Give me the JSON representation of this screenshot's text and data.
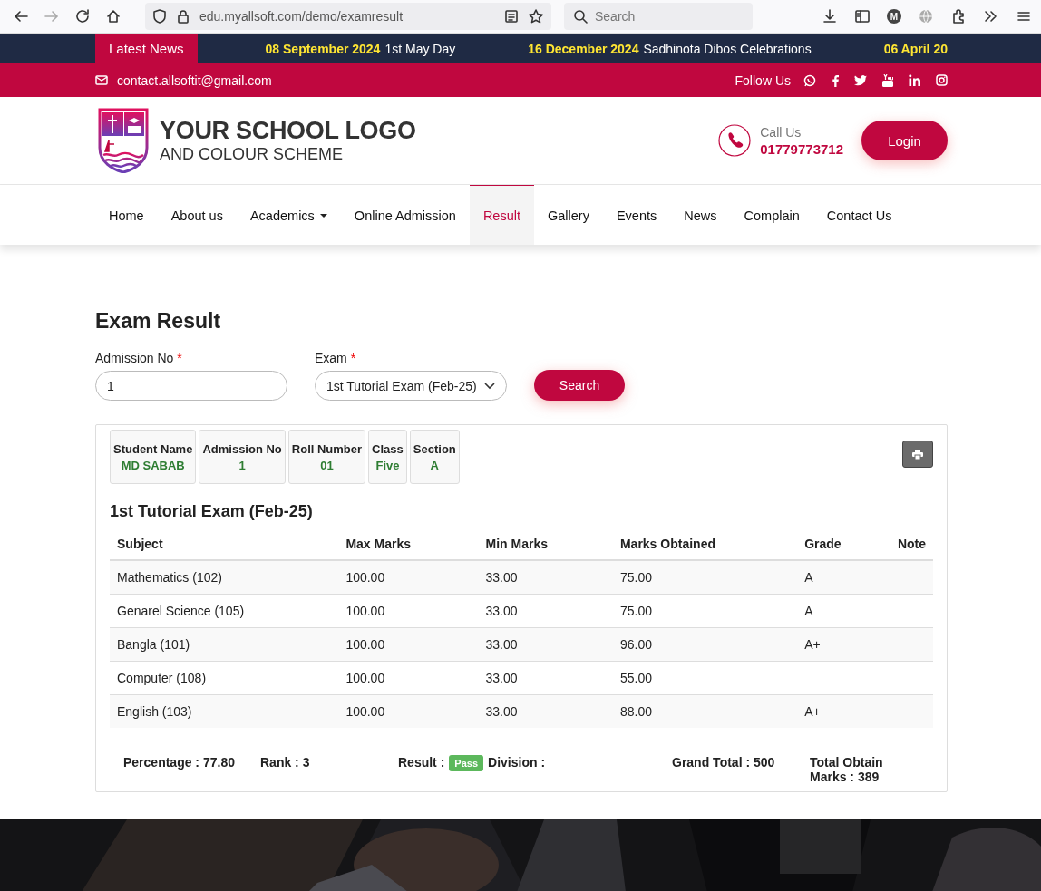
{
  "browser": {
    "url": "edu.myallsoft.com/demo/examresult",
    "search": {
      "placeholder": "Search"
    },
    "profile_initial": "M"
  },
  "news": {
    "label": "Latest News",
    "items": [
      {
        "date": "08 September 2024",
        "title": "1st May Day"
      },
      {
        "date": "16 December 2024",
        "title": "Sadhinota Dibos Celebrations"
      },
      {
        "date": "06 April 20"
      }
    ]
  },
  "contact": {
    "email": "contact.allsoftit@gmail.com",
    "follow_label": "Follow Us"
  },
  "header": {
    "logo_title": "YOUR SCHOOL LOGO",
    "logo_subtitle": "AND COLOUR SCHEME",
    "call_label": "Call Us",
    "phone": "01779773712",
    "login": "Login"
  },
  "nav": {
    "items": [
      {
        "label": "Home",
        "kind": "link",
        "selected": false
      },
      {
        "label": "About us",
        "kind": "link",
        "selected": false
      },
      {
        "label": "Academics",
        "kind": "dropdown",
        "selected": false
      },
      {
        "label": "Online Admission",
        "kind": "link",
        "selected": false
      },
      {
        "label": "Result",
        "kind": "link",
        "selected": true
      },
      {
        "label": "Gallery",
        "kind": "link",
        "selected": false
      },
      {
        "label": "Events",
        "kind": "link",
        "selected": false
      },
      {
        "label": "News",
        "kind": "link",
        "selected": false
      },
      {
        "label": "Complain",
        "kind": "link",
        "selected": false
      },
      {
        "label": "Contact Us",
        "kind": "link",
        "selected": false
      }
    ]
  },
  "form": {
    "title": "Exam Result",
    "fields": [
      {
        "label": "Admission No",
        "required_mark": "*",
        "kind": "text",
        "value": "1"
      },
      {
        "label": "Exam",
        "required_mark": "*",
        "kind": "select",
        "value": "1st Tutorial Exam (Feb-25)"
      }
    ],
    "button": "Search"
  },
  "result": {
    "info": [
      {
        "label": "Student Name",
        "value": "MD SABAB"
      },
      {
        "label": "Admission No",
        "value": "1"
      },
      {
        "label": "Roll Number",
        "value": "01"
      },
      {
        "label": "Class",
        "value": "Five"
      },
      {
        "label": "Section",
        "value": "A"
      }
    ],
    "exam_title": "1st Tutorial Exam (Feb-25)",
    "columns": [
      "Subject",
      "Max Marks",
      "Min Marks",
      "Marks Obtained",
      "Grade",
      "Note"
    ],
    "rows": [
      {
        "subject": "Mathematics (102)",
        "max": "100.00",
        "min": "33.00",
        "obtained": "75.00",
        "grade": "A"
      },
      {
        "subject": "Genarel Science (105)",
        "max": "100.00",
        "min": "33.00",
        "obtained": "75.00",
        "grade": "A"
      },
      {
        "subject": "Bangla (101)",
        "max": "100.00",
        "min": "33.00",
        "obtained": "96.00",
        "grade": "A+"
      },
      {
        "subject": "Computer (108)",
        "max": "100.00",
        "min": "33.00",
        "obtained": "55.00"
      },
      {
        "subject": "English (103)",
        "max": "100.00",
        "min": "33.00",
        "obtained": "88.00",
        "grade": "A+"
      }
    ],
    "summary": {
      "percentage": "Percentage : 77.80",
      "rank": "Rank : 3",
      "result_label": "Result :",
      "result_badge": "Pass",
      "division": "Division :",
      "grand_total": "Grand Total : 500",
      "total_obtain": "Total Obtain Marks : 389"
    }
  }
}
